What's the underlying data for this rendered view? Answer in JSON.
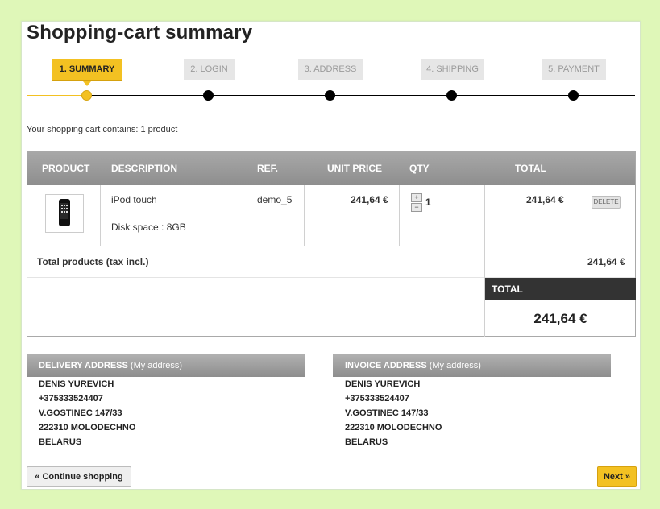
{
  "page": {
    "title": "Shopping-cart summary",
    "cart_info": "Your shopping cart contains: 1 product"
  },
  "steps": [
    {
      "label": "1. SUMMARY",
      "active": true
    },
    {
      "label": "2. LOGIN",
      "active": false
    },
    {
      "label": "3. ADDRESS",
      "active": false
    },
    {
      "label": "4. SHIPPING",
      "active": false
    },
    {
      "label": "5. PAYMENT",
      "active": false
    }
  ],
  "table": {
    "headers": [
      "PRODUCT",
      "DESCRIPTION",
      "REF.",
      "UNIT PRICE",
      "QTY",
      "TOTAL"
    ],
    "item": {
      "name": "iPod touch",
      "attribute": "Disk space : 8GB",
      "ref": "demo_5",
      "unit_price": "241,64 €",
      "qty_plus": "+",
      "qty_minus": "−",
      "qty": "1",
      "total": "241,64 €",
      "delete_label": "DELETE"
    },
    "total_products_label": "Total products (tax incl.)",
    "total_products_value": "241,64 €",
    "total_label": "TOTAL",
    "total_value": "241,64 €"
  },
  "delivery": {
    "title": "DELIVERY ADDRESS",
    "subtitle": "(My address)",
    "lines": [
      "DENIS YUREVICH",
      "+375333524407",
      "V.GOSTINEC 147/33",
      "222310 MOLODECHNO",
      "BELARUS"
    ]
  },
  "invoice": {
    "title": "INVOICE ADDRESS",
    "subtitle": "(My address)",
    "lines": [
      "DENIS YUREVICH",
      "+375333524407",
      "V.GOSTINEC 147/33",
      "222310 MOLODECHNO",
      "BELARUS"
    ]
  },
  "buttons": {
    "continue": "« Continue shopping",
    "next": "Next »"
  },
  "colors": {
    "accent": "#f3c122",
    "page_background": "#dff7b8",
    "header_grey": "#999999",
    "dark_total": "#333333"
  }
}
